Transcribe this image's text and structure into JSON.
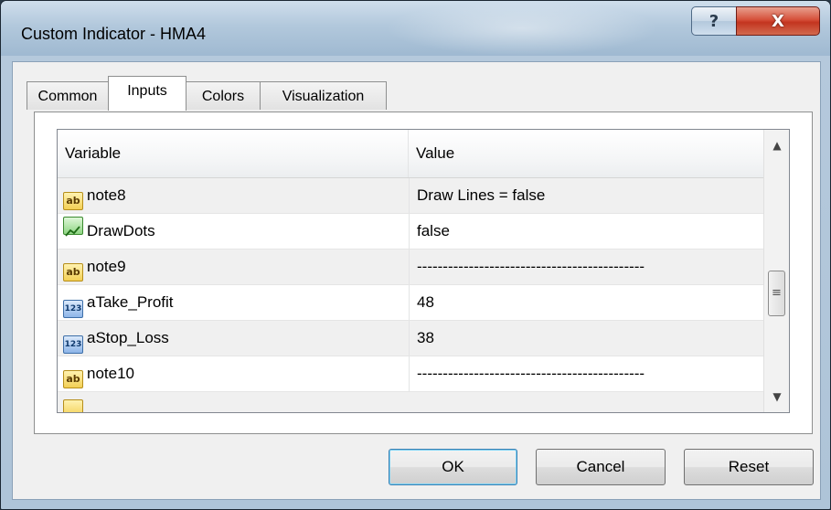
{
  "window": {
    "title": "Custom Indicator - HMA4",
    "help_label": "?",
    "close_label": "X"
  },
  "tabs": [
    {
      "label": "Common"
    },
    {
      "label": "Inputs"
    },
    {
      "label": "Colors"
    },
    {
      "label": "Visualization"
    }
  ],
  "grid": {
    "columns": {
      "variable": "Variable",
      "value": "Value"
    },
    "rows": [
      {
        "icon": "ab",
        "variable": "note8",
        "value": "Draw Lines = false"
      },
      {
        "icon": "",
        "variable": "DrawDots",
        "value": "false"
      },
      {
        "icon": "ab",
        "variable": "note9",
        "value": "--------------------------------------------"
      },
      {
        "icon": "123",
        "variable": "aTake_Profit",
        "value": "48"
      },
      {
        "icon": "123",
        "variable": "aStop_Loss",
        "value": "38"
      },
      {
        "icon": "ab",
        "variable": "note10",
        "value": "--------------------------------------------"
      }
    ]
  },
  "scrollbar": {
    "up": "▲",
    "down": "▼",
    "grip": "≡"
  },
  "buttons": {
    "ok": "OK",
    "cancel": "Cancel",
    "reset": "Reset"
  }
}
